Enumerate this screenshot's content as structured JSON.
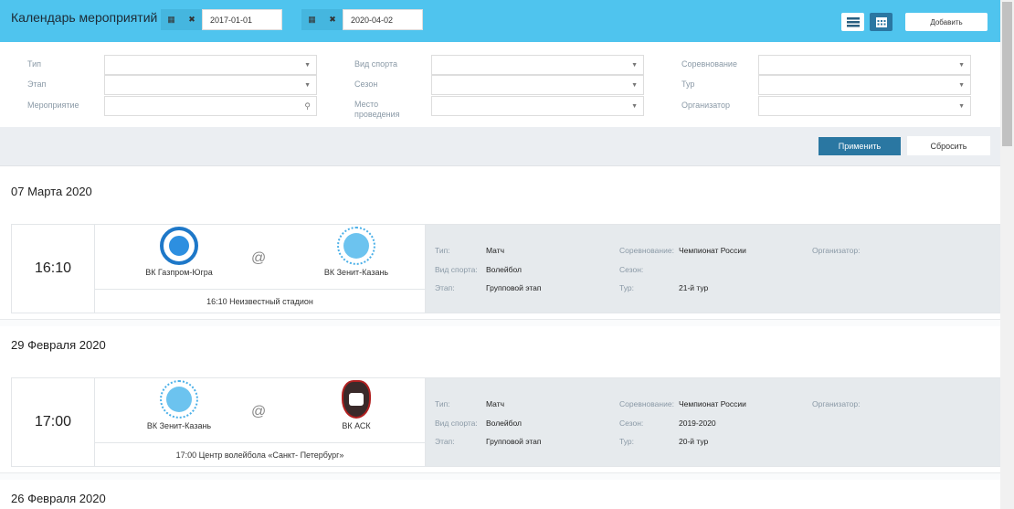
{
  "header": {
    "title": "Календарь мероприятий",
    "date_from": "2017-01-01",
    "date_to": "2020-04-02",
    "add_label": "Добавить"
  },
  "filters": {
    "type": "Тип",
    "stage": "Этап",
    "event": "Мероприятие",
    "sport": "Вид спорта",
    "season": "Сезон",
    "venue": "Место проведения",
    "competition": "Соревнование",
    "round": "Тур",
    "organizer": "Организатор"
  },
  "actions": {
    "apply": "Применить",
    "reset": "Сбросить"
  },
  "labels": {
    "type": "Тип:",
    "sport": "Вид спорта:",
    "stage": "Этап:",
    "competition": "Соревнование:",
    "season": "Сезон:",
    "round": "Тур:",
    "organizer": "Организатор:",
    "at": "@"
  },
  "days": [
    {
      "date": "07 Марта 2020",
      "time": "16:10",
      "home": "ВК Газпром-Югра",
      "away": "ВК Зенит-Казань",
      "venue": "16:10 Неизвестный стадион",
      "type": "Матч",
      "sport": "Волейбол",
      "stage": "Групповой этап",
      "competition": "Чемпионат России",
      "season": "",
      "round": "21-й тур",
      "organizer": ""
    },
    {
      "date": "29 Февраля 2020",
      "time": "17:00",
      "home": "ВК Зенит-Казань",
      "away": "ВК АСК",
      "venue": "17:00 Центр волейбола «Санкт- Петербург»",
      "type": "Матч",
      "sport": "Волейбол",
      "stage": "Групповой этап",
      "competition": "Чемпионат России",
      "season": "2019-2020",
      "round": "20-й тур",
      "organizer": ""
    },
    {
      "date": "26 Февраля 2020"
    }
  ],
  "colors": {
    "header": "#4fc4ee",
    "primary": "#2a77a2"
  }
}
